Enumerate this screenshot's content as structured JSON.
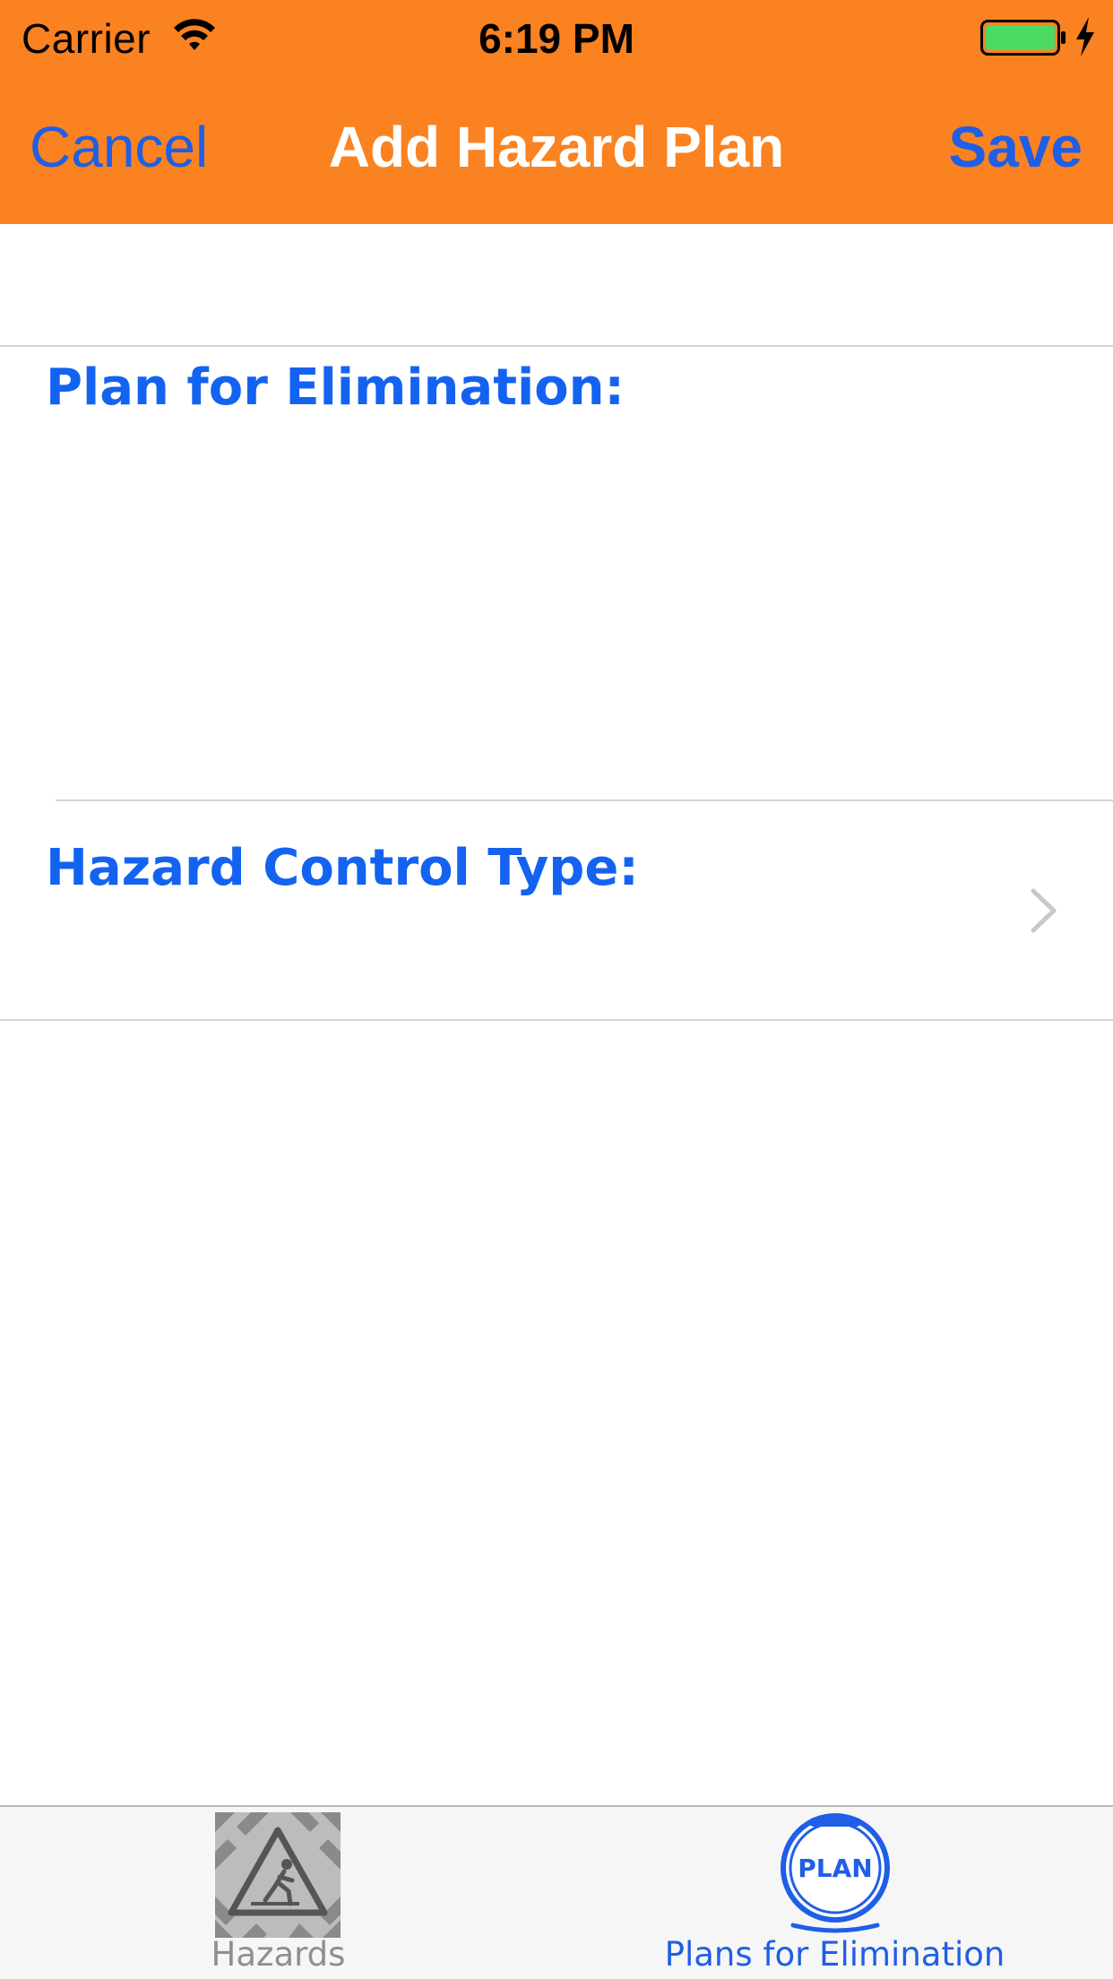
{
  "status_bar": {
    "carrier": "Carrier",
    "time": "6:19 PM",
    "wifi_icon": "wifi-icon",
    "battery_icon": "battery-icon",
    "charging_icon": "charging-bolt-icon",
    "battery_level": 1.0
  },
  "nav_bar": {
    "cancel_label": "Cancel",
    "title": "Add Hazard Plan",
    "save_label": "Save",
    "background_color": "#fa8221",
    "button_color": "#1f5ee6"
  },
  "form": {
    "plan_label": "Plan for Elimination:",
    "plan_value": "",
    "control_type_label": "Hazard Control Type:",
    "control_type_value": "",
    "disclosure_icon": "chevron-right-icon",
    "label_color": "#1463f0"
  },
  "tab_bar": {
    "tabs": [
      {
        "label": "Hazards",
        "icon": "hazard-warning-icon",
        "selected": false
      },
      {
        "label": "Plans for Elimination",
        "icon": "plan-badge-icon",
        "selected": true
      }
    ],
    "plan_icon_text": "PLAN",
    "active_color": "#1f5ee6",
    "inactive_color": "#8e8e93"
  }
}
